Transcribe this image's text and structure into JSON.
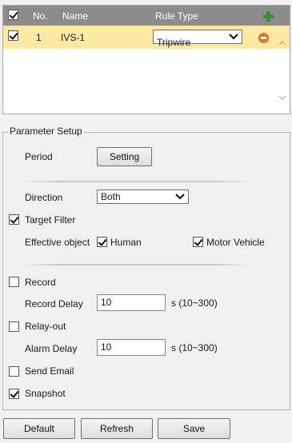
{
  "rules": {
    "header": {
      "no": "No.",
      "name": "Name",
      "rule_type": "Rule Type",
      "select_all_checked": true
    },
    "rows": [
      {
        "checked": true,
        "no": "1",
        "name": "IVS-1",
        "rule_type": "Tripwire"
      }
    ]
  },
  "parameter_setup": {
    "legend": "Parameter Setup",
    "period": {
      "label": "Period",
      "button": "Setting"
    },
    "direction": {
      "label": "Direction",
      "value": "Both"
    },
    "target_filter": {
      "label": "Target Filter",
      "checked": true
    },
    "effective_object": {
      "label": "Effective object",
      "human": {
        "label": "Human",
        "checked": true
      },
      "motor_vehicle": {
        "label": "Motor Vehicle",
        "checked": true
      }
    },
    "record": {
      "label": "Record",
      "checked": false
    },
    "record_delay": {
      "label": "Record Delay",
      "value": "10",
      "unit": "s (10~300)"
    },
    "relay_out": {
      "label": "Relay-out",
      "checked": false
    },
    "alarm_delay": {
      "label": "Alarm Delay",
      "value": "10",
      "unit": "s (10~300)"
    },
    "send_email": {
      "label": "Send Email",
      "checked": false
    },
    "snapshot": {
      "label": "Snapshot",
      "checked": true
    }
  },
  "footer": {
    "default_label": "Default",
    "refresh_label": "Refresh",
    "save_label": "Save"
  },
  "colors": {
    "header_bg": "#8c8c8c",
    "selected_row_bg": "#fde9a3",
    "add_icon": "#2e9e2e",
    "remove_icon": "#e8731f"
  }
}
